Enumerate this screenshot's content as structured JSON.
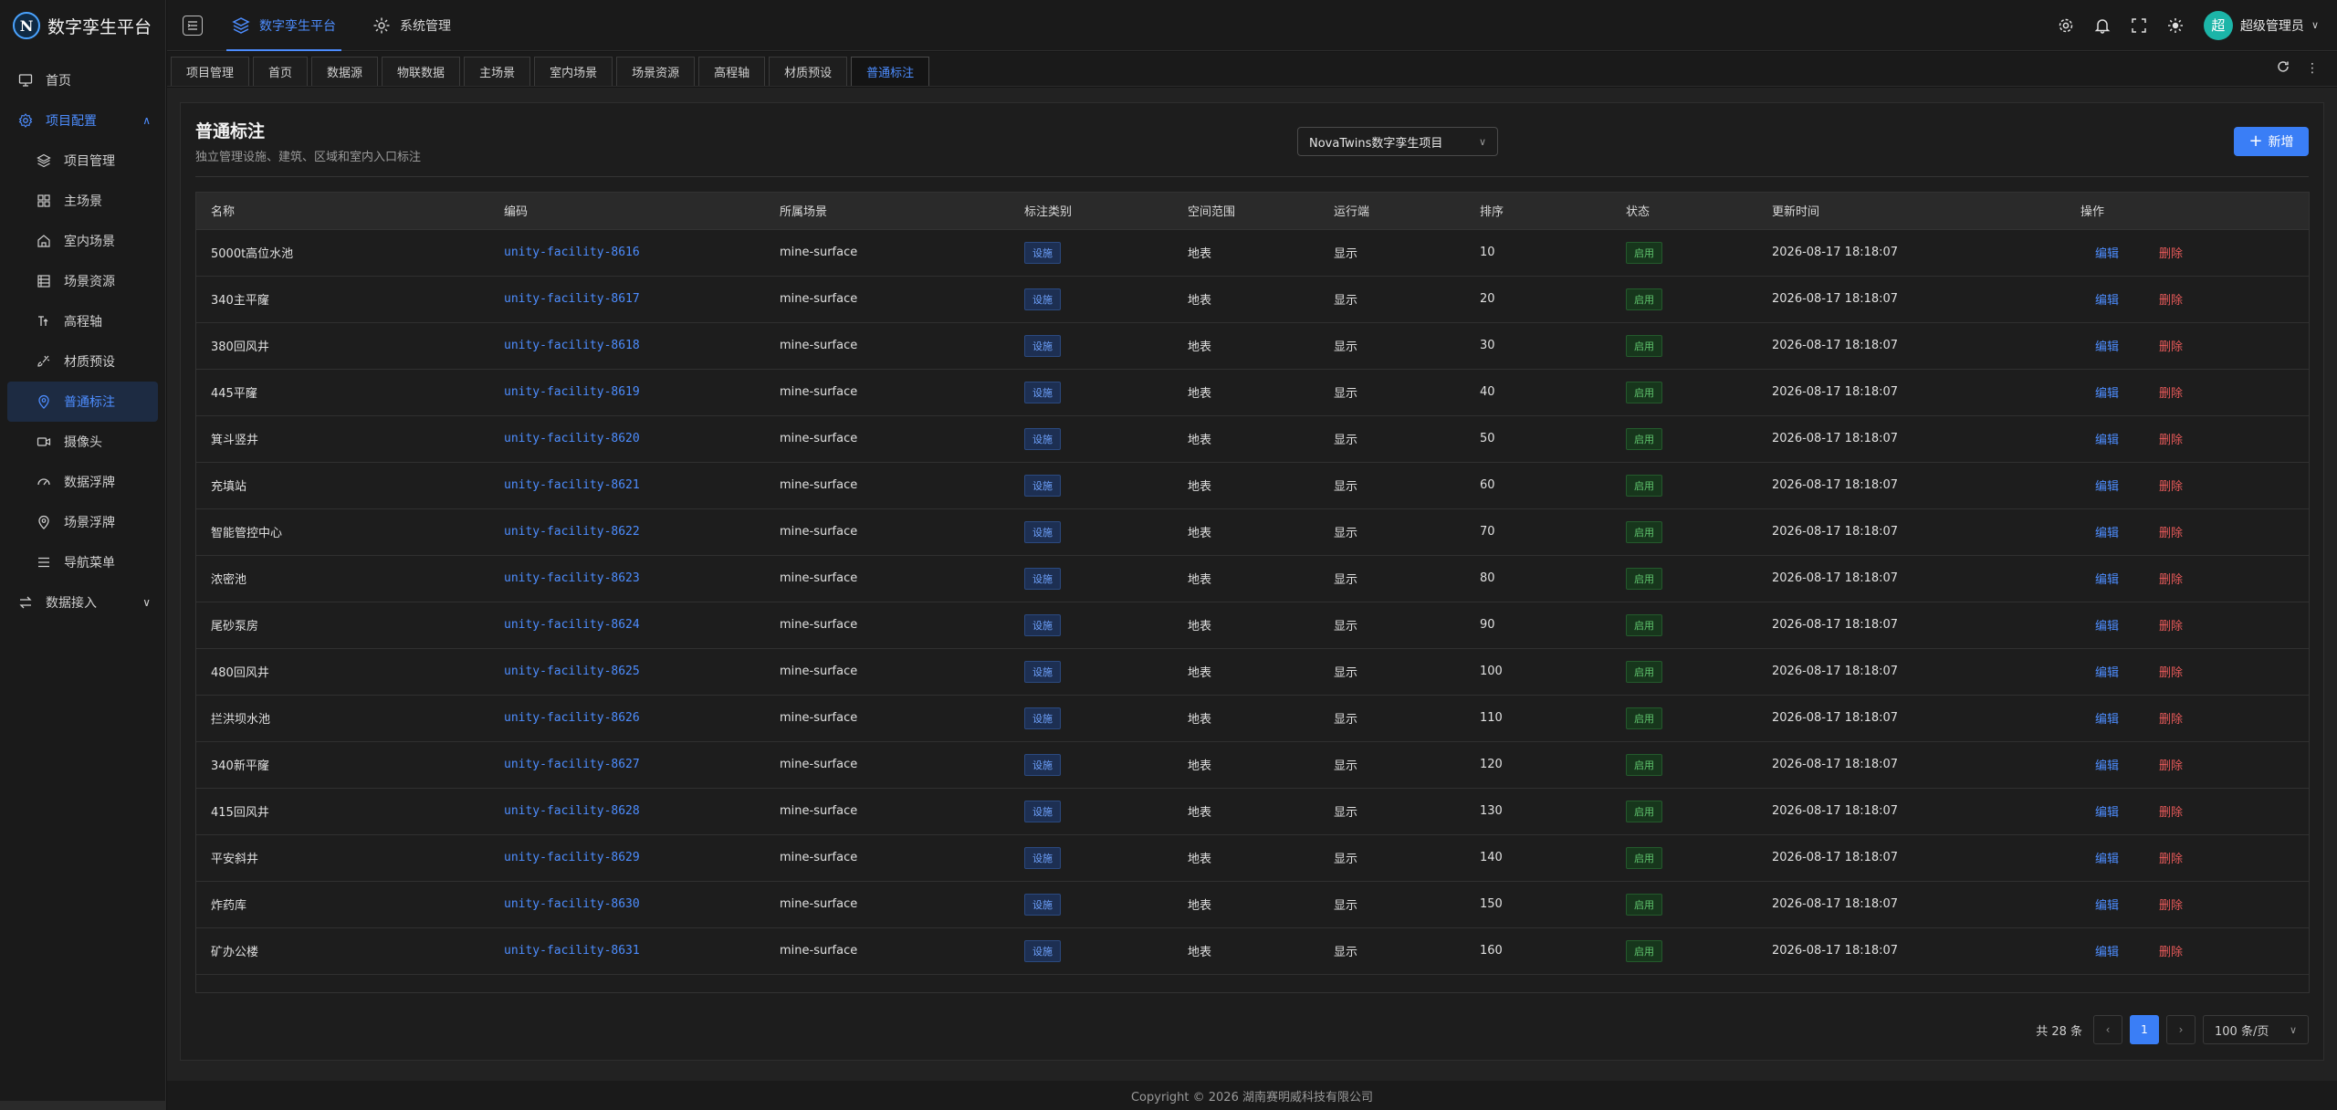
{
  "brand": {
    "logo_letter": "N",
    "title": "数字孪生平台"
  },
  "sidebar": {
    "items": [
      {
        "label": "首页",
        "icon": "monitor-icon",
        "level": 0
      },
      {
        "label": "项目配置",
        "icon": "gear-icon",
        "level": 0,
        "expanded": true
      },
      {
        "label": "项目管理",
        "icon": "layers-icon",
        "level": 1
      },
      {
        "label": "主场景",
        "icon": "grid-icon",
        "level": 1
      },
      {
        "label": "室内场景",
        "icon": "house-icon",
        "level": 1
      },
      {
        "label": "场景资源",
        "icon": "list-icon",
        "level": 1
      },
      {
        "label": "高程轴",
        "icon": "elevation-icon",
        "level": 1
      },
      {
        "label": "材质预设",
        "icon": "brush-icon",
        "level": 1
      },
      {
        "label": "普通标注",
        "icon": "pin-icon",
        "level": 1,
        "active": true
      },
      {
        "label": "摄像头",
        "icon": "camera-icon",
        "level": 1
      },
      {
        "label": "数据浮牌",
        "icon": "gauge-icon",
        "level": 1
      },
      {
        "label": "场景浮牌",
        "icon": "pin-icon",
        "level": 1
      },
      {
        "label": "导航菜单",
        "icon": "menu-icon",
        "level": 1
      },
      {
        "label": "数据接入",
        "icon": "swap-icon",
        "level": 0,
        "expanded": false
      }
    ]
  },
  "header": {
    "tabs": [
      {
        "label": "数字孪生平台",
        "active": true
      },
      {
        "label": "系统管理",
        "active": false
      }
    ],
    "user": {
      "avatar_text": "超",
      "name": "超级管理员"
    }
  },
  "page_tabs": [
    "项目管理",
    "首页",
    "数据源",
    "物联数据",
    "主场景",
    "室内场景",
    "场景资源",
    "高程轴",
    "材质预设",
    "普通标注"
  ],
  "page_tabs_active": 9,
  "card": {
    "title": "普通标注",
    "subtitle": "独立管理设施、建筑、区域和室内入口标注",
    "project_select": "NovaTwins数字孪生项目",
    "add_label": "新增"
  },
  "table": {
    "columns": [
      "名称",
      "编码",
      "所属场景",
      "标注类别",
      "空间范围",
      "运行端",
      "排序",
      "状态",
      "更新时间",
      "操作"
    ],
    "edit_label": "编辑",
    "delete_label": "删除",
    "rows": [
      {
        "name": "5000t高位水池",
        "code": "unity-facility-8616",
        "scene": "mine-surface",
        "type": "设施",
        "range": "地表",
        "runtime": "显示",
        "order": "10",
        "status": "启用",
        "updated": "2026-08-17 18:18:07"
      },
      {
        "name": "340主平窿",
        "code": "unity-facility-8617",
        "scene": "mine-surface",
        "type": "设施",
        "range": "地表",
        "runtime": "显示",
        "order": "20",
        "status": "启用",
        "updated": "2026-08-17 18:18:07"
      },
      {
        "name": "380回风井",
        "code": "unity-facility-8618",
        "scene": "mine-surface",
        "type": "设施",
        "range": "地表",
        "runtime": "显示",
        "order": "30",
        "status": "启用",
        "updated": "2026-08-17 18:18:07"
      },
      {
        "name": "445平窿",
        "code": "unity-facility-8619",
        "scene": "mine-surface",
        "type": "设施",
        "range": "地表",
        "runtime": "显示",
        "order": "40",
        "status": "启用",
        "updated": "2026-08-17 18:18:07"
      },
      {
        "name": "箕斗竖井",
        "code": "unity-facility-8620",
        "scene": "mine-surface",
        "type": "设施",
        "range": "地表",
        "runtime": "显示",
        "order": "50",
        "status": "启用",
        "updated": "2026-08-17 18:18:07"
      },
      {
        "name": "充填站",
        "code": "unity-facility-8621",
        "scene": "mine-surface",
        "type": "设施",
        "range": "地表",
        "runtime": "显示",
        "order": "60",
        "status": "启用",
        "updated": "2026-08-17 18:18:07"
      },
      {
        "name": "智能管控中心",
        "code": "unity-facility-8622",
        "scene": "mine-surface",
        "type": "设施",
        "range": "地表",
        "runtime": "显示",
        "order": "70",
        "status": "启用",
        "updated": "2026-08-17 18:18:07"
      },
      {
        "name": "浓密池",
        "code": "unity-facility-8623",
        "scene": "mine-surface",
        "type": "设施",
        "range": "地表",
        "runtime": "显示",
        "order": "80",
        "status": "启用",
        "updated": "2026-08-17 18:18:07"
      },
      {
        "name": "尾砂泵房",
        "code": "unity-facility-8624",
        "scene": "mine-surface",
        "type": "设施",
        "range": "地表",
        "runtime": "显示",
        "order": "90",
        "status": "启用",
        "updated": "2026-08-17 18:18:07"
      },
      {
        "name": "480回风井",
        "code": "unity-facility-8625",
        "scene": "mine-surface",
        "type": "设施",
        "range": "地表",
        "runtime": "显示",
        "order": "100",
        "status": "启用",
        "updated": "2026-08-17 18:18:07"
      },
      {
        "name": "拦洪坝水池",
        "code": "unity-facility-8626",
        "scene": "mine-surface",
        "type": "设施",
        "range": "地表",
        "runtime": "显示",
        "order": "110",
        "status": "启用",
        "updated": "2026-08-17 18:18:07"
      },
      {
        "name": "340新平窿",
        "code": "unity-facility-8627",
        "scene": "mine-surface",
        "type": "设施",
        "range": "地表",
        "runtime": "显示",
        "order": "120",
        "status": "启用",
        "updated": "2026-08-17 18:18:07"
      },
      {
        "name": "415回风井",
        "code": "unity-facility-8628",
        "scene": "mine-surface",
        "type": "设施",
        "range": "地表",
        "runtime": "显示",
        "order": "130",
        "status": "启用",
        "updated": "2026-08-17 18:18:07"
      },
      {
        "name": "平安斜井",
        "code": "unity-facility-8629",
        "scene": "mine-surface",
        "type": "设施",
        "range": "地表",
        "runtime": "显示",
        "order": "140",
        "status": "启用",
        "updated": "2026-08-17 18:18:07"
      },
      {
        "name": "炸药库",
        "code": "unity-facility-8630",
        "scene": "mine-surface",
        "type": "设施",
        "range": "地表",
        "runtime": "显示",
        "order": "150",
        "status": "启用",
        "updated": "2026-08-17 18:18:07"
      },
      {
        "name": "矿办公楼",
        "code": "unity-facility-8631",
        "scene": "mine-surface",
        "type": "设施",
        "range": "地表",
        "runtime": "显示",
        "order": "160",
        "status": "启用",
        "updated": "2026-08-17 18:18:07"
      }
    ]
  },
  "pagination": {
    "total_text": "共 28 条",
    "current_page": "1",
    "page_size": "100 条/页"
  },
  "footer": {
    "copyright": "Copyright © 2026 湖南赛明威科技有限公司"
  },
  "colors": {
    "accent": "#3a7ef6",
    "danger": "#e85a5a",
    "success": "#5fc46d",
    "background": "#141414"
  }
}
